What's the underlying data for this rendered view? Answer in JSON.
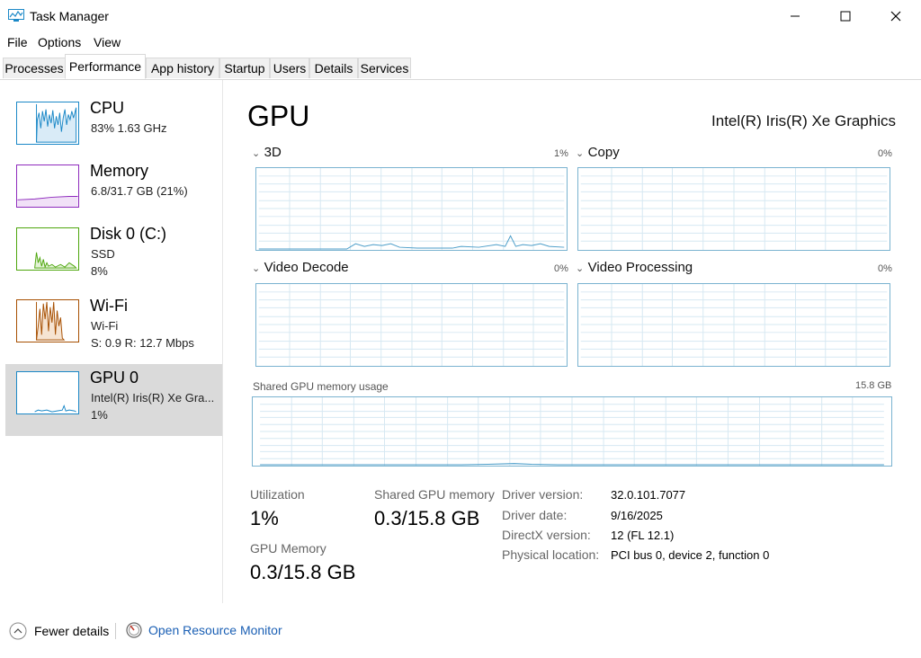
{
  "window": {
    "title": "Task Manager",
    "minimize_icon": "minimize-icon",
    "maximize_icon": "maximize-icon",
    "close_icon": "close-icon"
  },
  "menu": [
    "File",
    "Options",
    "View"
  ],
  "tabs": [
    "Processes",
    "Performance",
    "App history",
    "Startup",
    "Users",
    "Details",
    "Services"
  ],
  "active_tab": "Performance",
  "sidebar": {
    "items": [
      {
        "name": "CPU",
        "line2": "83%  1.63 GHz",
        "line3": "",
        "color": "#1b88c7",
        "utilization": 0.83
      },
      {
        "name": "Memory",
        "line2": "6.8/31.7 GB (21%)",
        "line3": "",
        "color": "#8e2bbd",
        "utilization": 0.21
      },
      {
        "name": "Disk 0 (C:)",
        "line2": "SSD",
        "line3": "8%",
        "color": "#4da60c",
        "utilization": 0.08
      },
      {
        "name": "Wi-Fi",
        "line2": "Wi-Fi",
        "line3": "S: 0.9  R: 12.7 Mbps",
        "color": "#a74f01",
        "utilization": 0.5
      },
      {
        "name": "GPU 0",
        "line2": "Intel(R) Iris(R) Xe Gra...",
        "line3": "1%",
        "color": "#1b88c7",
        "utilization": 0.01
      }
    ]
  },
  "main": {
    "title": "GPU",
    "model": "Intel(R) Iris(R) Xe Graphics",
    "graphs": [
      {
        "label": "3D",
        "pct": "1%"
      },
      {
        "label": "Copy",
        "pct": "0%"
      },
      {
        "label": "Video Decode",
        "pct": "0%"
      },
      {
        "label": "Video Processing",
        "pct": "0%"
      }
    ],
    "shared": {
      "label": "Shared GPU memory usage",
      "max": "15.8 GB"
    },
    "stats": {
      "utilization_label": "Utilization",
      "utilization_value": "1%",
      "shared_label": "Shared GPU memory",
      "shared_value": "0.3/15.8 GB",
      "gpu_mem_label": "GPU Memory",
      "gpu_mem_value": "0.3/15.8 GB"
    },
    "info": [
      {
        "label": "Driver version:",
        "value": "32.0.101.7077"
      },
      {
        "label": "Driver date:",
        "value": "9/16/2025"
      },
      {
        "label": "DirectX version:",
        "value": "12 (FL 12.1)"
      },
      {
        "label": "Physical location:",
        "value": "PCI bus 0, device 2, function 0"
      }
    ],
    "accent": "#7ab3d0"
  },
  "footer": {
    "fewer_details": "Fewer details",
    "fewer_icon": "chevron-up-icon",
    "resource_monitor": "Open Resource Monitor",
    "resource_icon": "resource-monitor-icon"
  }
}
